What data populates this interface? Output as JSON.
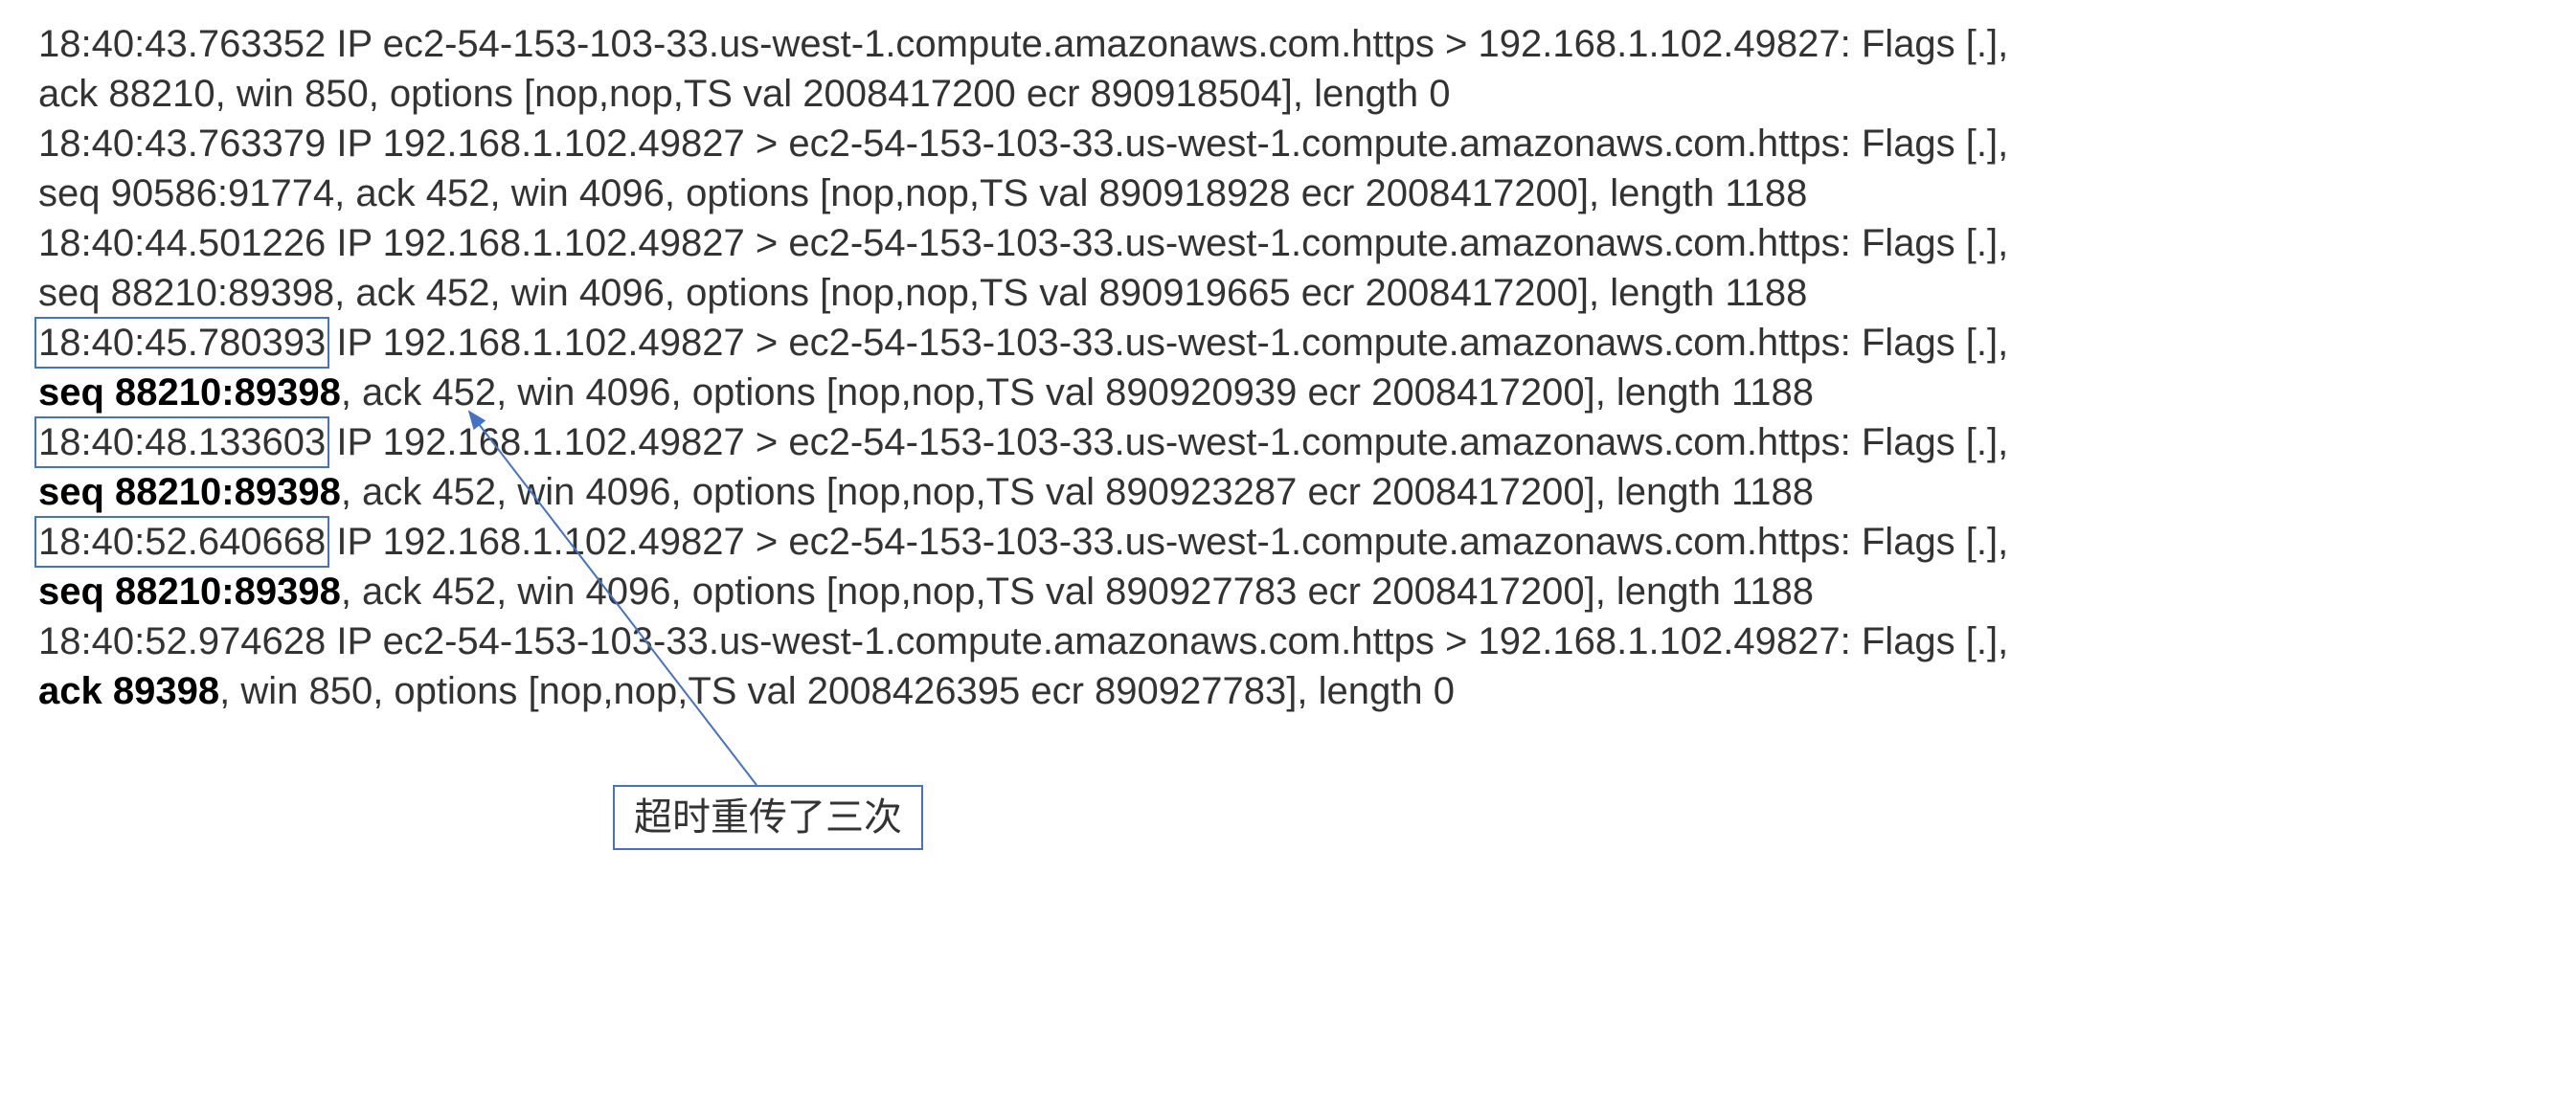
{
  "packets": {
    "p1_a": "18:40:43.763352 IP ec2-54-153-103-33.us-west-1.compute.amazonaws.com.https > 192.168.1.102.49827: Flags [.],",
    "p1_b": "ack 88210, win 850, options [nop,nop,TS val 2008417200 ecr 890918504], length 0",
    "p2_a": "18:40:43.763379 IP 192.168.1.102.49827 > ec2-54-153-103-33.us-west-1.compute.amazonaws.com.https: Flags [.],",
    "p2_b": "seq 90586:91774, ack 452, win 4096, options [nop,nop,TS val 890918928 ecr 2008417200], length 1188",
    "p3_a": "18:40:44.501226 IP 192.168.1.102.49827 > ec2-54-153-103-33.us-west-1.compute.amazonaws.com.https: Flags [.],",
    "p3_b": "seq 88210:89398, ack 452, win 4096, options [nop,nop,TS val 890919665 ecr 2008417200], length 1188",
    "p4_ts": "18:40:45.780393",
    "p4_rest": " IP 192.168.1.102.49827 > ec2-54-153-103-33.us-west-1.compute.amazonaws.com.https: Flags [.],",
    "p4_seq": "seq 88210:89398",
    "p4_tail": ", ack 452, win 4096, options [nop,nop,TS val 890920939 ecr 2008417200], length 1188",
    "p5_ts": "18:40:48.133603",
    "p5_rest": " IP 192.168.1.102.49827 > ec2-54-153-103-33.us-west-1.compute.amazonaws.com.https: Flags [.],",
    "p5_seq": "seq 88210:89398",
    "p5_tail": ", ack 452, win 4096, options [nop,nop,TS val 890923287 ecr 2008417200], length 1188",
    "p6_ts": "18:40:52.640668",
    "p6_rest": " IP 192.168.1.102.49827 > ec2-54-153-103-33.us-west-1.compute.amazonaws.com.https: Flags [.],",
    "p6_seq": "seq 88210:89398",
    "p6_tail": ", ack 452, win 4096, options [nop,nop,TS val 890927783 ecr 2008417200], length 1188",
    "p7_a": "18:40:52.974628 IP ec2-54-153-103-33.us-west-1.compute.amazonaws.com.https > 192.168.1.102.49827: Flags [.],",
    "p7_ack": "ack 89398",
    "p7_tail": ", win 850, options [nop,nop,TS val 2008426395 ecr 890927783], length 0"
  },
  "callout": {
    "label": "超时重传了三次"
  },
  "colors": {
    "box_border": "#4472c4"
  }
}
